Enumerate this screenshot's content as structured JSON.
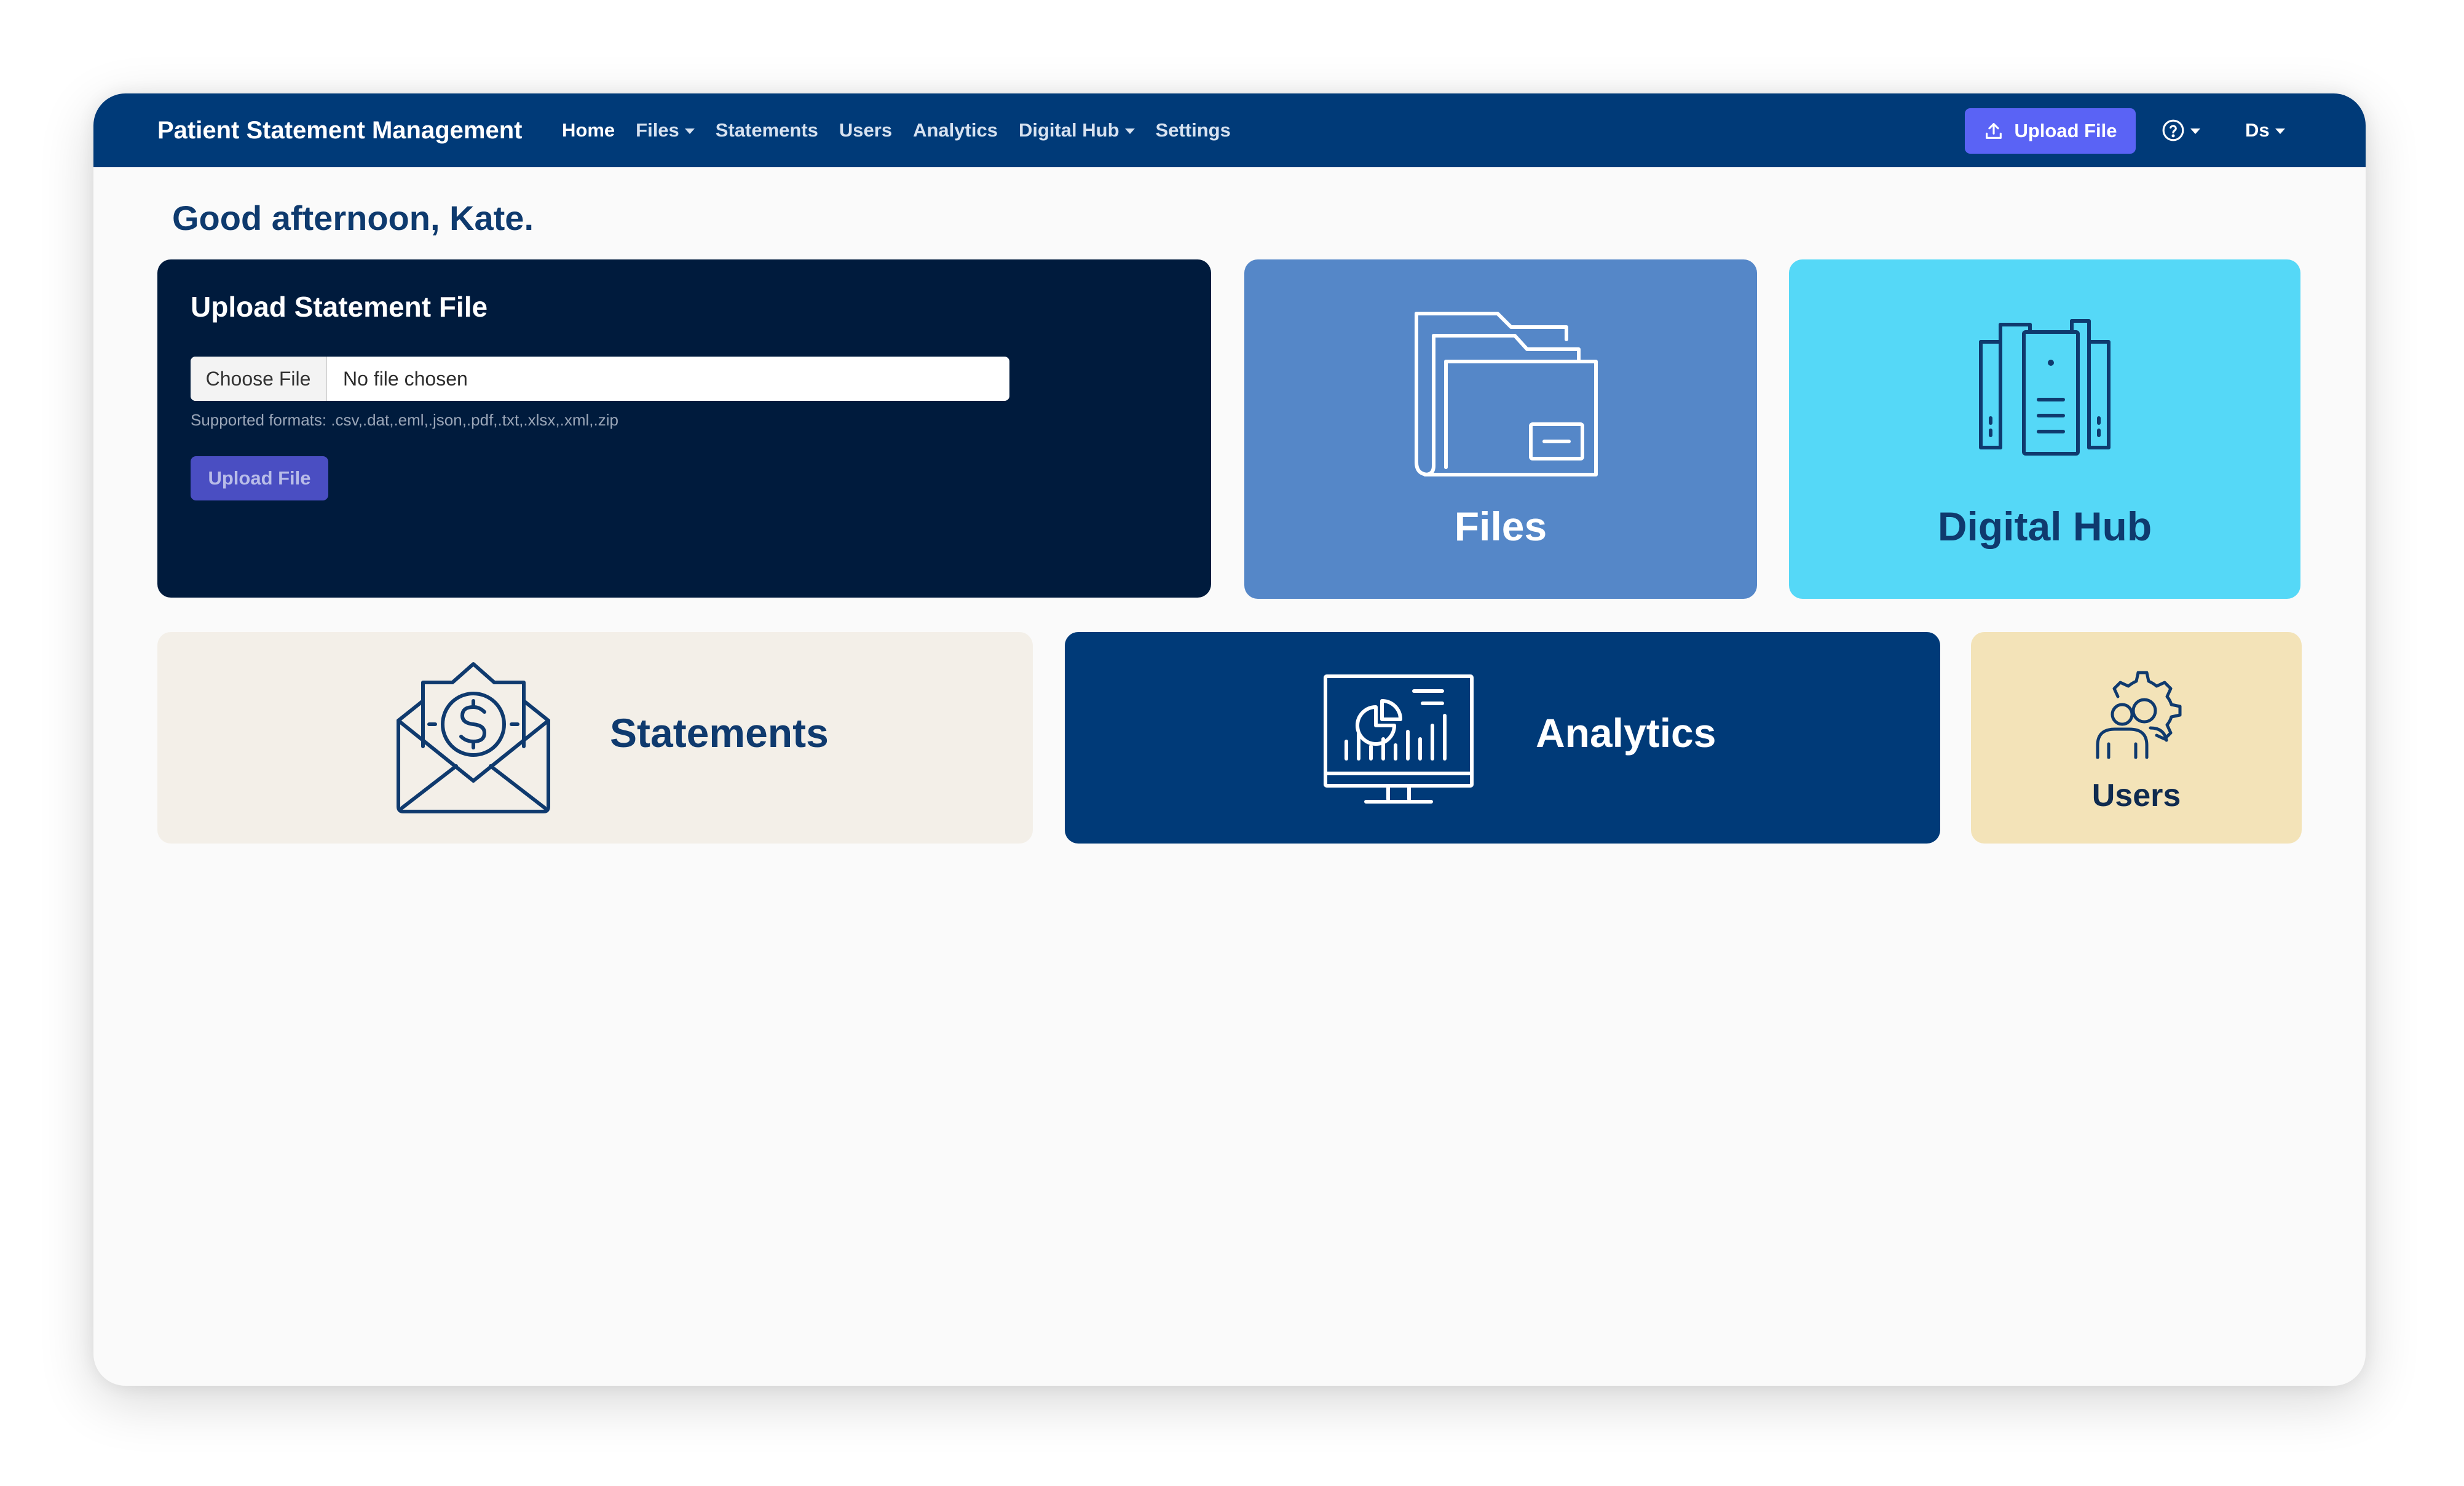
{
  "navbar": {
    "brand": "Patient Statement Management",
    "links": [
      {
        "label": "Home",
        "active": true,
        "dropdown": false
      },
      {
        "label": "Files",
        "active": false,
        "dropdown": true
      },
      {
        "label": "Statements",
        "active": false,
        "dropdown": false
      },
      {
        "label": "Users",
        "active": false,
        "dropdown": false
      },
      {
        "label": "Analytics",
        "active": false,
        "dropdown": false
      },
      {
        "label": "Digital Hub",
        "active": false,
        "dropdown": true
      },
      {
        "label": "Settings",
        "active": false,
        "dropdown": false
      }
    ],
    "upload_button": "Upload File",
    "user_initials": "Ds",
    "icons": {
      "upload": "upload-icon",
      "help": "help-circle-icon"
    }
  },
  "greeting": "Good afternoon, Kate.",
  "upload_card": {
    "title": "Upload Statement File",
    "choose_button": "Choose File",
    "file_status": "No file chosen",
    "formats": "Supported formats: .csv,.dat,.eml,.json,.pdf,.txt,.xlsx,.xml,.zip",
    "submit_button": "Upload File"
  },
  "tiles": {
    "files": {
      "label": "Files",
      "icon": "folder-icon"
    },
    "digital_hub": {
      "label": "Digital Hub",
      "icon": "server-icon"
    },
    "statements": {
      "label": "Statements",
      "icon": "envelope-dollar-icon"
    },
    "analytics": {
      "label": "Analytics",
      "icon": "monitor-chart-icon"
    },
    "users": {
      "label": "Users",
      "icon": "user-gear-icon"
    }
  },
  "colors": {
    "navbar": "#003a78",
    "upload_card": "#001b3d",
    "files_tile": "#5587c8",
    "digital_hub_tile": "#55d8f7",
    "statements_tile": "#f3efe8",
    "analytics_tile": "#003a78",
    "users_tile": "#f3e3b8",
    "accent_button": "#5a63f5",
    "heading_text": "#0e3a6e"
  }
}
